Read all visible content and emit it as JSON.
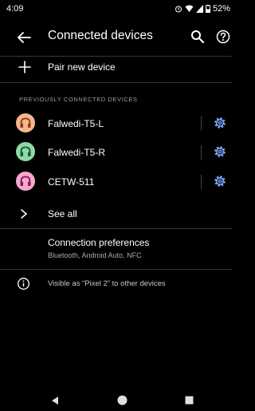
{
  "status_bar": {
    "time": "4:09",
    "battery": "52%"
  },
  "app_bar": {
    "title": "Connected devices"
  },
  "pair": {
    "label": "Pair new device"
  },
  "section": {
    "header": "PREVIOUSLY CONNECTED DEVICES"
  },
  "devices": [
    {
      "name": "Falwedi-T5-L",
      "avatar_bg": "#f7b58c",
      "avatar_fg": "#8a3d12"
    },
    {
      "name": "Falwedi-T5-R",
      "avatar_bg": "#8fd9a8",
      "avatar_fg": "#0f5a2e"
    },
    {
      "name": "CETW-511",
      "avatar_bg": "#f7a8cf",
      "avatar_fg": "#8a1553"
    }
  ],
  "see_all": {
    "label": "See all"
  },
  "preferences": {
    "title": "Connection preferences",
    "subtitle": "Bluetooth, Android Auto, NFC"
  },
  "info": {
    "text": "Visible as “Pixel 2” to other devices"
  },
  "colors": {
    "background": "#000000",
    "accent": "#7aa8f5",
    "divider": "#333333"
  },
  "icons": {
    "back": "arrow-back-icon",
    "search": "search-icon",
    "help": "help-icon",
    "add": "plus-icon",
    "settings": "gear-icon",
    "expand": "chevron-right-icon",
    "info": "info-icon"
  }
}
